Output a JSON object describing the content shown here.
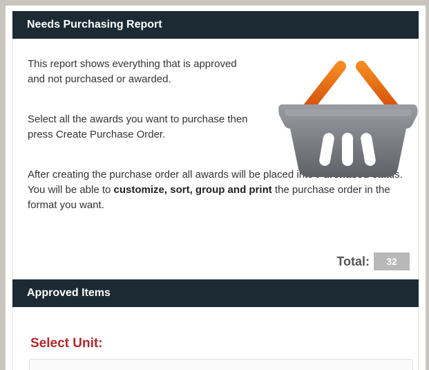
{
  "report": {
    "title": "Needs Purchasing Report",
    "description_1": "This report shows everything that is approved and not purchased or awarded.",
    "description_2": "Select all the awards you want to purchase then press Create Purchase Order.",
    "description_3_part1": "After creating the purchase order all awards will be placed into ",
    "description_3_bold1": "Purchased",
    "description_3_part2": " status. You will be able to ",
    "description_3_bold2": "customize, sort, group and print",
    "description_3_part3": " the purchase order in the format you want.",
    "icon": "shopping-basket-icon",
    "total_label": "Total:",
    "total_value": "32"
  },
  "approved": {
    "title": "Approved Items",
    "select_unit_label": "Select Unit:"
  },
  "colors": {
    "header_bg": "#1c2a33",
    "accent_red": "#b5272d",
    "basket_handle": "#e8680e",
    "basket_body": "#7d7f86",
    "total_badge": "#b8b8b8"
  }
}
